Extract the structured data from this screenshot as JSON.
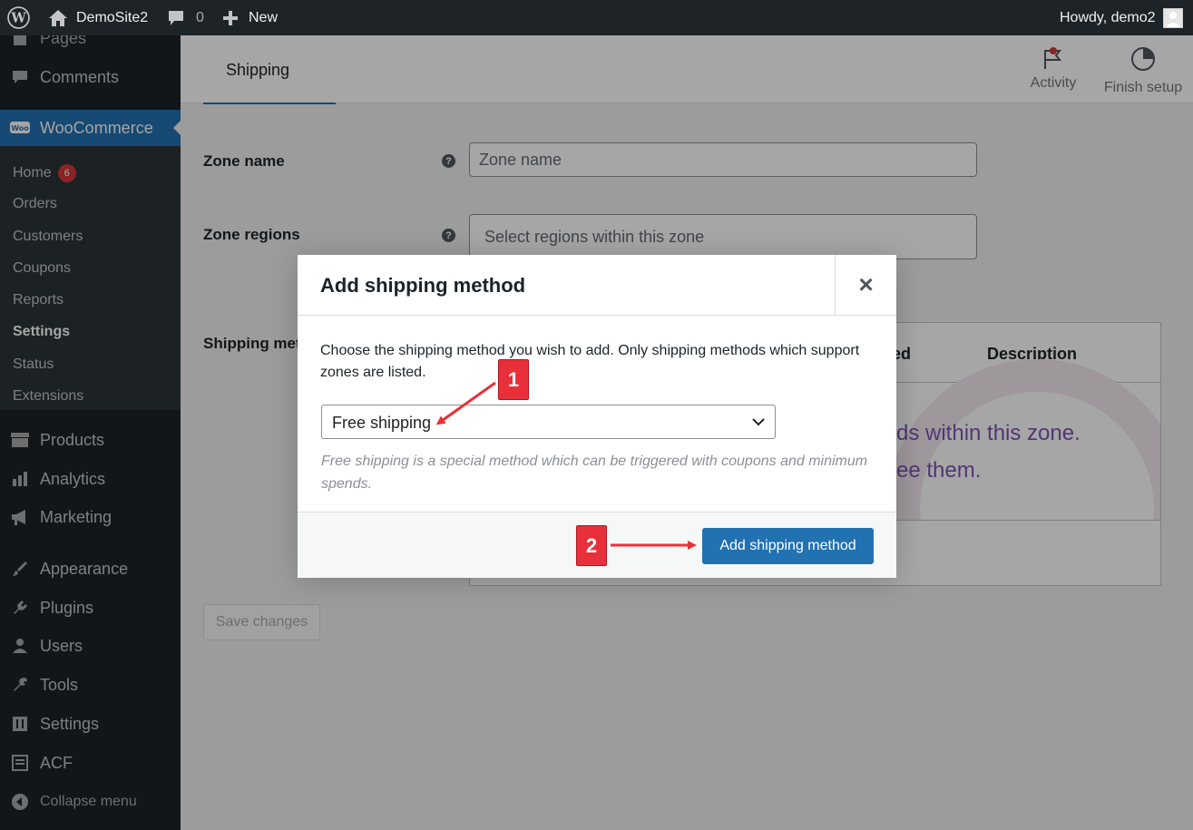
{
  "admin_bar": {
    "site_name": "DemoSite2",
    "comments_count": "0",
    "new_label": "New",
    "greeting": "Howdy, demo2"
  },
  "sidebar": {
    "partial_top": "Pages",
    "comments": "Comments",
    "woocommerce": "WooCommerce",
    "woo_sub": [
      {
        "label": "Home",
        "badge": "6"
      },
      {
        "label": "Orders"
      },
      {
        "label": "Customers"
      },
      {
        "label": "Coupons"
      },
      {
        "label": "Reports"
      },
      {
        "label": "Settings"
      },
      {
        "label": "Status"
      },
      {
        "label": "Extensions"
      }
    ],
    "items": [
      {
        "label": "Products",
        "icon": "archive-icon"
      },
      {
        "label": "Analytics",
        "icon": "bar-chart-icon"
      },
      {
        "label": "Marketing",
        "icon": "megaphone-icon"
      },
      {
        "label": "Appearance",
        "icon": "paintbrush-icon"
      },
      {
        "label": "Plugins",
        "icon": "plug-icon"
      },
      {
        "label": "Users",
        "icon": "user-icon"
      },
      {
        "label": "Tools",
        "icon": "wrench-icon"
      },
      {
        "label": "Settings",
        "icon": "settings-sliders-icon"
      },
      {
        "label": "ACF",
        "icon": "acf-grid-icon"
      }
    ],
    "collapse": "Collapse menu"
  },
  "header": {
    "title": "Shipping",
    "activity": "Activity",
    "finish_setup": "Finish setup"
  },
  "form": {
    "zone_name_label": "Zone name",
    "zone_name_placeholder": "Zone name",
    "zone_regions_label": "Zone regions",
    "zone_regions_placeholder": "Select regions within this zone",
    "shipping_methods_label": "Shipping met",
    "table_col_enabled": "ed",
    "table_col_description": "Description",
    "empty_line1": "ds within this zone.",
    "empty_line2": "ee them.",
    "save_button": "Save changes"
  },
  "modal": {
    "title": "Add shipping method",
    "close": "×",
    "intro": "Choose the shipping method you wish to add. Only shipping methods which support zones are listed.",
    "select_value": "Free shipping",
    "description": "Free shipping is a special method which can be triggered with coupons and minimum spends.",
    "add_button": "Add shipping method"
  },
  "annotations": {
    "badge1": "1",
    "badge2": "2"
  },
  "colors": {
    "admin_dark": "#1d2327",
    "wp_blue": "#2271b1",
    "annotation_red": "#e8303a",
    "notification_red": "#d63638"
  }
}
